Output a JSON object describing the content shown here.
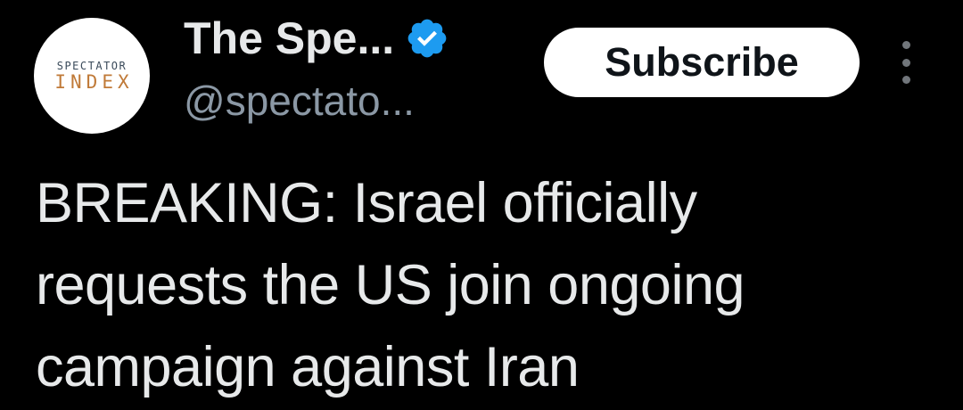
{
  "author": {
    "avatar": {
      "line1": "SPECTATOR",
      "line2": "INDEX"
    },
    "display_name": "The Spe...",
    "handle": "@spectato...",
    "verified": true,
    "verified_color": "#1d9bf0"
  },
  "actions": {
    "subscribe_label": "Subscribe",
    "more_icon": "more-vertical-icon"
  },
  "tweet": {
    "lines": [
      "BREAKING: Israel officially",
      "requests the US join ongoing",
      "campaign against Iran"
    ]
  },
  "colors": {
    "background": "#000000",
    "text": "#e7e9ea",
    "secondary_text": "#8b98a5",
    "button_bg": "#ffffff",
    "button_text": "#0f1419"
  }
}
